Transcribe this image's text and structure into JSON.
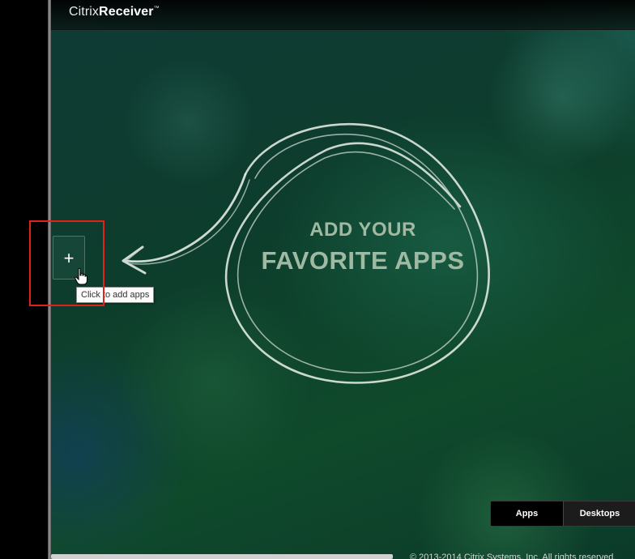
{
  "header": {
    "brand_light": "Citrix",
    "brand_bold": "Receiver",
    "trademark": "™"
  },
  "hero": {
    "line1": "ADD YOUR",
    "line2": "FAVORITE APPS"
  },
  "add_apps": {
    "symbol": "+",
    "tooltip": "Click to add apps"
  },
  "tabs": [
    {
      "label": "Apps",
      "active": true
    },
    {
      "label": "Desktops",
      "active": false
    }
  ],
  "footer": {
    "copyright": "© 2013-2014 Citrix Systems, Inc. All rights reserved."
  },
  "icons": [
    "plus-icon",
    "hand-cursor-icon",
    "chalk-arrow-icon",
    "chalk-circle-icon"
  ],
  "colors": {
    "background": "#0e3f2e",
    "headline": "#9fb9a3",
    "highlight_box": "#e0221c",
    "tab_bar": "#0b0b0b"
  }
}
